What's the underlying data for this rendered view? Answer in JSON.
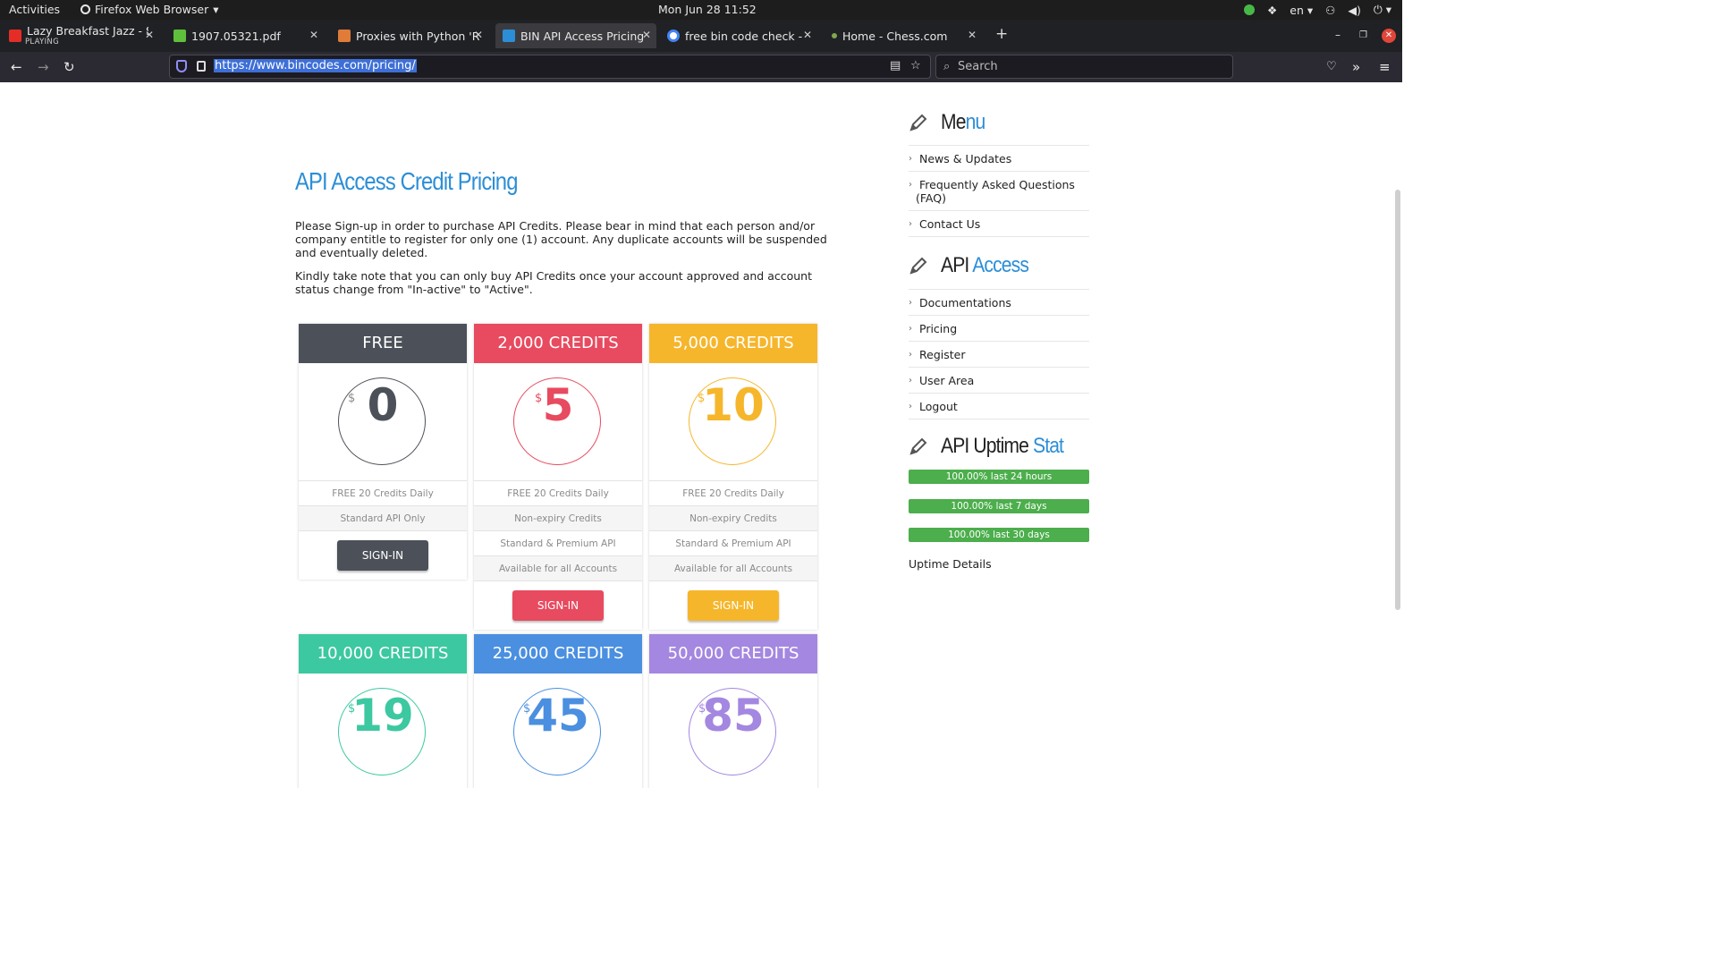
{
  "topbar": {
    "activities": "Activities",
    "app_name": "Firefox Web Browser",
    "clock": "Mon Jun 28  11:52",
    "language": "en"
  },
  "tabs": [
    {
      "title": "Lazy Breakfast Jazz - Smo",
      "subtitle": "PLAYING",
      "favicon_color": "#e52d27"
    },
    {
      "title": "1907.05321.pdf",
      "favicon_color": "#5ec03b"
    },
    {
      "title": "Proxies with Python 'Req",
      "favicon_color": "#e07b39"
    },
    {
      "title": "BIN API Access Pricing",
      "favicon_color": "#2c8ed6"
    },
    {
      "title": "free bin code check - Goo",
      "favicon_color": "#4285f4"
    },
    {
      "title": "Home - Chess.com",
      "favicon_color": "#7fa650"
    }
  ],
  "navbar": {
    "url": "https://www.bincodes.com/pricing/",
    "search_placeholder": "Search"
  },
  "page": {
    "title": "API Access Credit Pricing",
    "intro_1": "Please Sign-up in order to purchase API Credits. Please bear in mind that each person and/or company entitle to register for only one (1) account. Any duplicate accounts will be suspended and eventually deleted.",
    "intro_2": "Kindly take note that you can only buy API Credits once your account approved and account status change from \"In-active\" to \"Active\"."
  },
  "plans": [
    {
      "name": "FREE",
      "currency": "$",
      "price": "0",
      "color": "#4c5159",
      "price_color": "#4c5159",
      "features": [
        "FREE 20 Credits Daily",
        "Standard API Only"
      ],
      "button": "SIGN-IN"
    },
    {
      "name": "2,000 CREDITS",
      "currency": "$",
      "price": "5",
      "color": "#e84a5f",
      "price_color": "#e84a5f",
      "features": [
        "FREE 20 Credits Daily",
        "Non-expiry Credits",
        "Standard & Premium API",
        "Available for all Accounts"
      ],
      "button": "SIGN-IN"
    },
    {
      "name": "5,000 CREDITS",
      "currency": "$",
      "price": "10",
      "color": "#f6b62b",
      "price_color": "#f6b62b",
      "features": [
        "FREE 20 Credits Daily",
        "Non-expiry Credits",
        "Standard & Premium API",
        "Available for all Accounts"
      ],
      "button": "SIGN-IN"
    },
    {
      "name": "10,000 CREDITS",
      "currency": "$",
      "price": "19",
      "color": "#3cc8a0",
      "price_color": "#3cc8a0"
    },
    {
      "name": "25,000 CREDITS",
      "currency": "$",
      "price": "45",
      "color": "#4a8fe0",
      "price_color": "#4a8fe0"
    },
    {
      "name": "50,000 CREDITS",
      "currency": "$",
      "price": "85",
      "color": "#a487e0",
      "price_color": "#a487e0"
    }
  ],
  "sidebar": {
    "menu_head_a": "Me",
    "menu_head_b": "nu",
    "menu_items": [
      "News & Updates",
      "Frequently Asked Questions (FAQ)",
      "Contact Us"
    ],
    "api_head_a": "API ",
    "api_head_b": "Access",
    "api_items": [
      "Documentations",
      "Pricing",
      "Register",
      "User Area",
      "Logout"
    ],
    "uptime_head_a": "API Uptime ",
    "uptime_head_b": "Stat",
    "uptime": [
      {
        "label": "100.00% last 24 hours",
        "value": 100
      },
      {
        "label": "100.00% last 7 days",
        "value": 100
      },
      {
        "label": "100.00% last 30 days",
        "value": 100
      }
    ],
    "uptime_link": "Uptime Details"
  }
}
